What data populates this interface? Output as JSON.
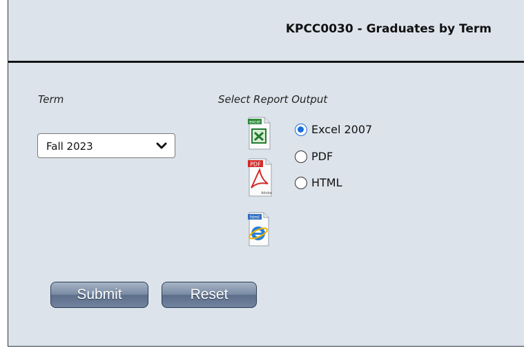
{
  "header": {
    "title": "KPCC0030 - Graduates by Term"
  },
  "term": {
    "label": "Term",
    "selected": "Fall 2023"
  },
  "output": {
    "label": "Select Report Output",
    "options": [
      {
        "label": "Excel 2007",
        "checked": true,
        "icon": "excel-file-icon"
      },
      {
        "label": "PDF",
        "checked": false,
        "icon": "pdf-file-icon"
      },
      {
        "label": "HTML",
        "checked": false,
        "icon": "html-file-icon"
      }
    ]
  },
  "buttons": {
    "submit_label": "Submit",
    "reset_label": "Reset"
  },
  "icons": {
    "excel_badge": "excel",
    "pdf_badge": "PDF",
    "pdf_caption": "Adobe",
    "html_badge": "html"
  },
  "colors": {
    "panel": "#dce3ea",
    "button": "#6d7f99",
    "radio_accent": "#1a6ed8"
  }
}
